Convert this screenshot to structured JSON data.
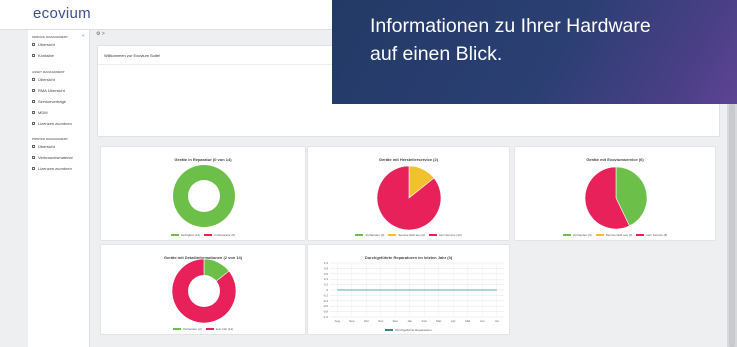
{
  "app": {
    "logo": "ecovium"
  },
  "breadcrumb": "⚙ >",
  "sidebar": {
    "collapse_icon": "«",
    "sections": [
      {
        "heading": "SERVICE MANAGEMENT",
        "items": [
          "Übersicht",
          "Kontakte"
        ]
      },
      {
        "heading": "ASSET MANAGEMENT",
        "items": [
          "Übersicht",
          "RMA Übersicht",
          "Serviceverträge",
          "MDM",
          "Lizenzen zuordnen"
        ]
      },
      {
        "heading": "PRINTER MANAGEMENT",
        "items": [
          "Übersicht",
          "Verbrauchsmaterial",
          "Lizenzen zuordnen"
        ]
      }
    ]
  },
  "welcome": {
    "text": "Willkommen zur Ecovium Suite!"
  },
  "banner": {
    "text": "Informationen zu Ihrer Hardware\nauf einen Blick."
  },
  "colors": {
    "green": "#6cc04a",
    "pink": "#e8215a",
    "yellow": "#f2c12e",
    "teal": "#2a8e86",
    "primary": "#3d4f8c"
  },
  "cards": {
    "repair": {
      "title": "Geräte in Reparatur (0 von 14)",
      "legend": [
        "Verfügbar (14)",
        "In Reparatur (0)"
      ]
    },
    "vendor": {
      "title": "Geräte mit Herstellerservice (2)",
      "legend": [
        "Vorhanden (0)",
        "Service läuft aus (2)",
        "kein Service (12)"
      ]
    },
    "ecovium": {
      "title": "Geräte mit Ecoviumservice (6)",
      "legend": [
        "Vorhanden (6)",
        "Service läuft aus (0)",
        "kein Service (8)"
      ]
    },
    "details": {
      "title": "Geräte mit Detailinformationen (2 von 14)",
      "legend": [
        "Vorhanden (2)",
        "kein Info (12)"
      ]
    },
    "repairs_year": {
      "title": "Durchgeführte Reparaturen im letzten Jahr (0)",
      "legend": [
        "Durchgeführte Reparaturen"
      ]
    }
  },
  "chart_data": [
    {
      "type": "pie",
      "title": "Geräte in Reparatur (0 von 14)",
      "labels": [
        "Verfügbar",
        "In Reparatur"
      ],
      "values": [
        14,
        0
      ],
      "donut": true
    },
    {
      "type": "pie",
      "title": "Geräte mit Herstellerservice (2)",
      "labels": [
        "Vorhanden",
        "Service läuft aus",
        "kein Service"
      ],
      "values": [
        0,
        2,
        12
      ]
    },
    {
      "type": "pie",
      "title": "Geräte mit Ecoviumservice (6)",
      "labels": [
        "Vorhanden",
        "Service läuft aus",
        "kein Service"
      ],
      "values": [
        6,
        0,
        8
      ]
    },
    {
      "type": "pie",
      "title": "Geräte mit Detailinformationen (2 von 14)",
      "labels": [
        "Vorhanden",
        "kein Info"
      ],
      "values": [
        2,
        12
      ],
      "donut": true
    },
    {
      "type": "line",
      "title": "Durchgeführte Reparaturen im letzten Jahr (0)",
      "categories": [
        "Aug",
        "Sep",
        "Okt",
        "Nov",
        "Dez",
        "Jan",
        "Feb",
        "Mar",
        "Apr",
        "Mai",
        "Jun",
        "Jul"
      ],
      "series": [
        {
          "name": "Durchgeführte Reparaturen",
          "values": [
            0,
            0,
            0,
            0,
            0,
            0,
            0,
            0,
            0,
            0,
            0,
            0
          ]
        }
      ],
      "yticks": [
        "1.0",
        "0.8",
        "0.6",
        "0.4",
        "0.2",
        "0",
        "-0.2",
        "-0.4",
        "-0.6",
        "-0.8",
        "-1.0"
      ],
      "ylim": [
        -1,
        1
      ]
    }
  ]
}
